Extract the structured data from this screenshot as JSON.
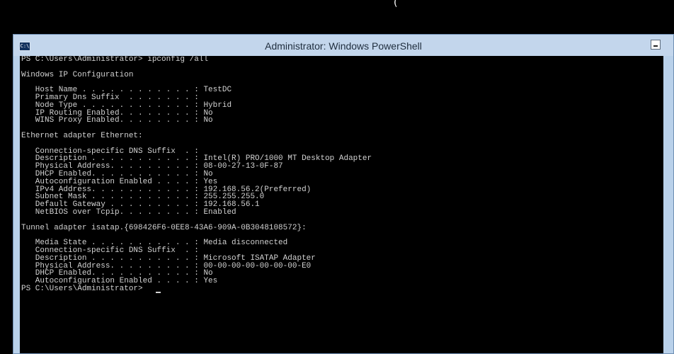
{
  "screen": {
    "top_stray_text": "("
  },
  "window": {
    "title": "Administrator: Windows PowerShell",
    "icon_label": "C:\\",
    "accent": "#b9d1ea"
  },
  "console": {
    "lines": [
      "PS C:\\Users\\Administrator> ipconfig /all",
      "",
      "Windows IP Configuration",
      "",
      "   Host Name . . . . . . . . . . . . : TestDC",
      "   Primary Dns Suffix  . . . . . . . :",
      "   Node Type . . . . . . . . . . . . : Hybrid",
      "   IP Routing Enabled. . . . . . . . : No",
      "   WINS Proxy Enabled. . . . . . . . : No",
      "",
      "Ethernet adapter Ethernet:",
      "",
      "   Connection-specific DNS Suffix  . :",
      "   Description . . . . . . . . . . . : Intel(R) PRO/1000 MT Desktop Adapter",
      "   Physical Address. . . . . . . . . : 08-00-27-13-0F-87",
      "   DHCP Enabled. . . . . . . . . . . : No",
      "   Autoconfiguration Enabled . . . . : Yes",
      "   IPv4 Address. . . . . . . . . . . : 192.168.56.2(Preferred)",
      "   Subnet Mask . . . . . . . . . . . : 255.255.255.0",
      "   Default Gateway . . . . . . . . . : 192.168.56.1",
      "   NetBIOS over Tcpip. . . . . . . . : Enabled",
      "",
      "Tunnel adapter isatap.{698426F6-0EE8-43A6-909A-0B3048108572}:",
      "",
      "   Media State . . . . . . . . . . . : Media disconnected",
      "   Connection-specific DNS Suffix  . :",
      "   Description . . . . . . . . . . . : Microsoft ISATAP Adapter",
      "   Physical Address. . . . . . . . . : 00-00-00-00-00-00-00-E0",
      "   DHCP Enabled. . . . . . . . . . . : No",
      "   Autoconfiguration Enabled . . . . : Yes",
      "PS C:\\Users\\Administrator> "
    ]
  }
}
